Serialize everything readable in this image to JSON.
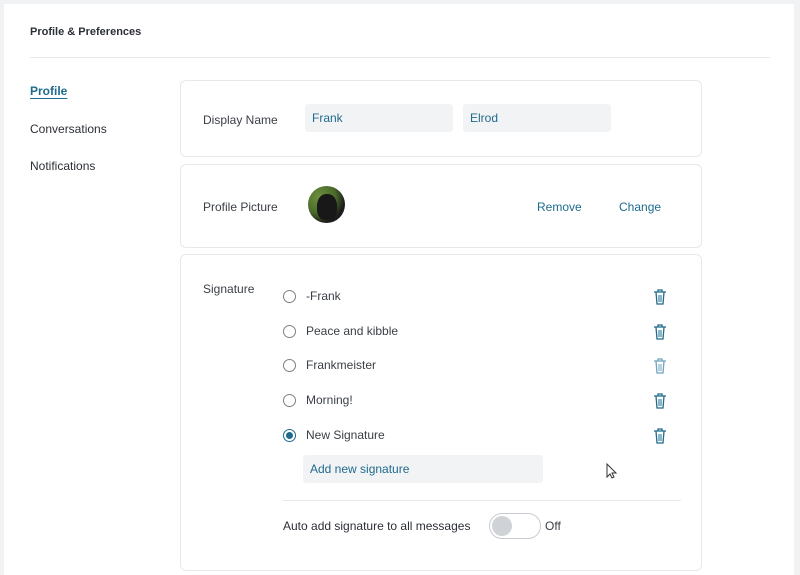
{
  "page": {
    "title": "Profile & Preferences"
  },
  "nav": {
    "items": [
      {
        "label": "Profile",
        "active": true
      },
      {
        "label": "Conversations",
        "active": false
      },
      {
        "label": "Notifications",
        "active": false
      }
    ]
  },
  "display_name": {
    "label": "Display Name",
    "first_name": "Frank",
    "last_name": "Elrod"
  },
  "profile_picture": {
    "label": "Profile Picture",
    "remove_label": "Remove",
    "change_label": "Change"
  },
  "signature": {
    "label": "Signature",
    "items": [
      {
        "text": "-Frank",
        "selected": false
      },
      {
        "text": "Peace and kibble",
        "selected": false
      },
      {
        "text": "Frankmeister",
        "selected": false
      },
      {
        "text": "Morning!",
        "selected": false
      },
      {
        "text": "New Signature",
        "selected": true
      }
    ],
    "add_placeholder": "Add new signature",
    "auto_add_label": "Auto add signature to all messages",
    "auto_add_state": "Off"
  },
  "colors": {
    "accent": "#1f6a8d",
    "text": "#2b2f36",
    "input_bg": "#f2f3f5"
  }
}
